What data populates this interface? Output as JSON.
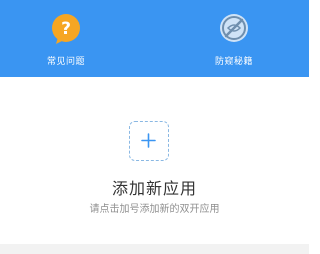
{
  "colors": {
    "header_background": "#3a95f2",
    "accent": "#3a95f2",
    "faq_icon_bg": "#f6a623",
    "mask_icon_bg": "#cfe3f7",
    "dashed_border": "#8ab8e3",
    "title_text": "#333333",
    "subtitle_text": "#8f8f8f",
    "footer_strip": "#f2f2f2"
  },
  "header": {
    "features": [
      {
        "label": "常见问题",
        "icon": "question-bubble-icon"
      },
      {
        "label": "防窥秘籍",
        "icon": "no-peeking-icon"
      }
    ]
  },
  "main": {
    "add_icon": "plus-icon",
    "title": "添加新应用",
    "subtitle": "请点击加号添加新的双开应用"
  }
}
